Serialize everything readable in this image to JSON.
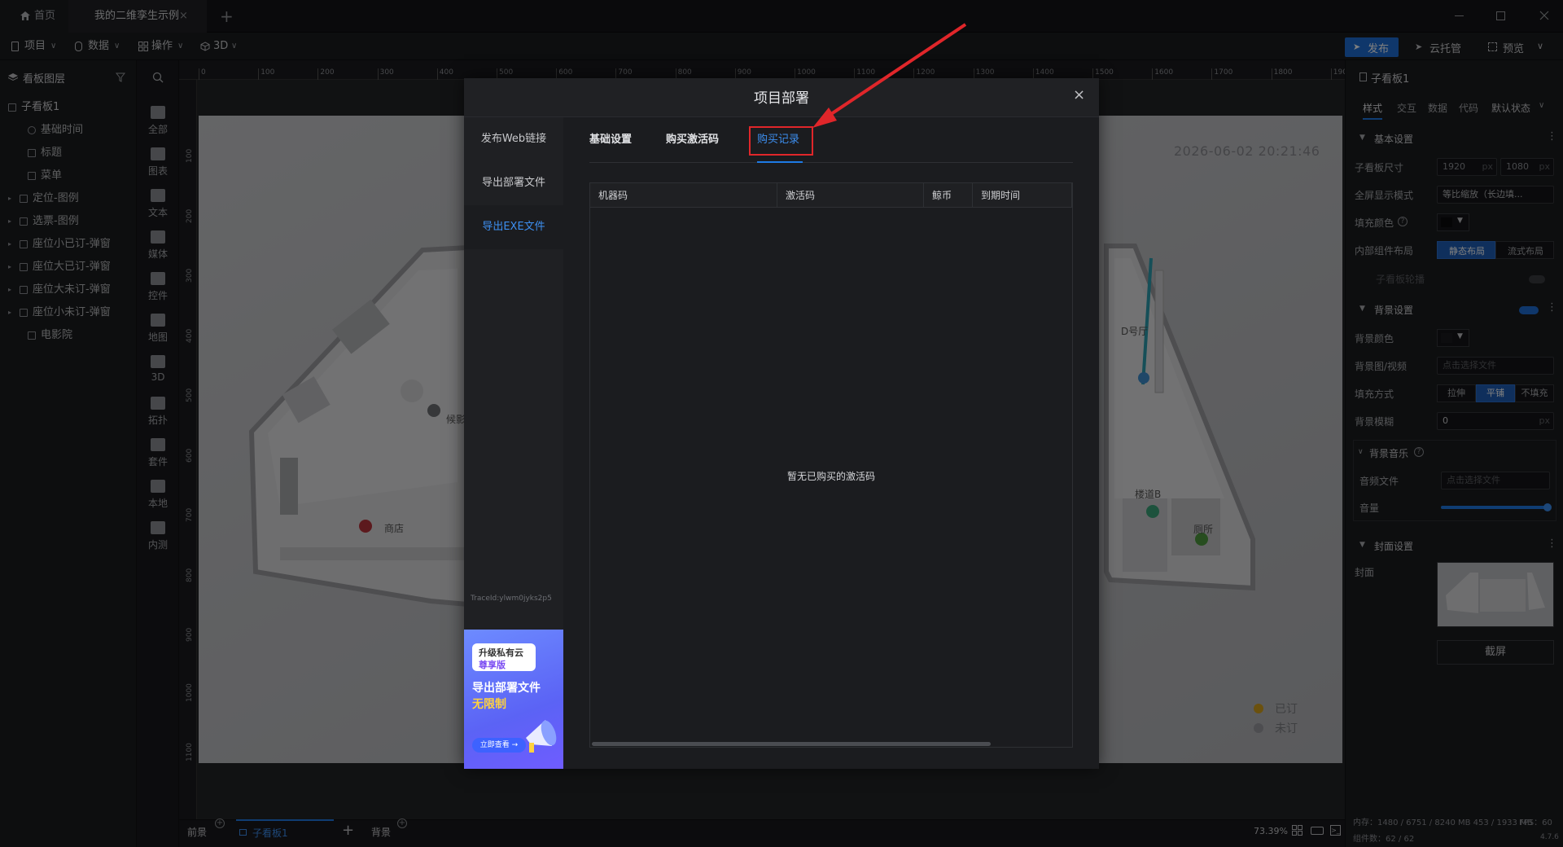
{
  "titlebar": {
    "home_tab": "首页",
    "doc_tab": "我的二维孪生示例",
    "close_glyph": "×",
    "add_glyph": "+"
  },
  "toolbar": {
    "project": "项目",
    "data": "数据",
    "operation": "操作",
    "three_d": "3D",
    "publish": "发布",
    "cloud": "云托管",
    "preview": "预览"
  },
  "left_panel": {
    "title": "看板图层",
    "items": [
      {
        "label": "子看板1",
        "icon": "monitor-icon"
      },
      {
        "label": "基础时间",
        "icon": "clock-icon"
      },
      {
        "label": "标题",
        "icon": "text-icon"
      },
      {
        "label": "菜单",
        "icon": "menu-icon"
      },
      {
        "label": "定位-图例",
        "icon": "folder-icon"
      },
      {
        "label": "选票-图例",
        "icon": "folder-icon"
      },
      {
        "label": "座位小已订-弹窗",
        "icon": "folder-icon"
      },
      {
        "label": "座位大已订-弹窗",
        "icon": "folder-icon"
      },
      {
        "label": "座位大未订-弹窗",
        "icon": "folder-icon"
      },
      {
        "label": "座位小未订-弹窗",
        "icon": "folder-icon"
      },
      {
        "label": "电影院",
        "icon": "image-icon"
      }
    ]
  },
  "icon_bar": {
    "categories": [
      "全部",
      "图表",
      "文本",
      "媒体",
      "控件",
      "地图",
      "3D",
      "拓扑",
      "套件",
      "本地",
      "内测"
    ]
  },
  "ruler": {
    "top_ticks": [
      "0",
      "100",
      "200",
      "300",
      "400",
      "500",
      "600",
      "700",
      "800",
      "900",
      "1000",
      "1100",
      "1200",
      "1300",
      "1400",
      "1500",
      "1600",
      "1700",
      "1800",
      "1900"
    ],
    "left_ticks": [
      "100",
      "200",
      "300",
      "400",
      "500",
      "600",
      "700",
      "800",
      "900",
      "1000",
      "1100"
    ]
  },
  "board": {
    "datetime": "2026-06-02 20:21:46",
    "labels": {
      "shop": "商店",
      "lounge": "候影",
      "hall_d": "D号厅",
      "stair_b": "楼道B",
      "toilet": "厕所"
    },
    "legend": {
      "booked": "已订",
      "free": "未订",
      "booked_color": "#d7a21d",
      "free_color": "#9a9ba0"
    }
  },
  "right_panel": {
    "title": "子看板1",
    "tabs": [
      "样式",
      "交互",
      "数据",
      "代码"
    ],
    "state_select": "默认状态",
    "basic_section": "基本设置",
    "size_label": "子看板尺寸",
    "width": "1920",
    "height": "1080",
    "unit": "px",
    "fullscreen_label": "全屏显示模式",
    "fullscreen_value": "等比缩放（长边填...",
    "fill_color_label": "填充颜色",
    "layout_label": "内部组件布局",
    "layout_static": "静态布局",
    "layout_flow": "流式布局",
    "carousel_label": "子看板轮播",
    "bg_section": "背景设置",
    "bg_color_label": "背景颜色",
    "bg_image_label": "背景图/视频",
    "bg_image_placeholder": "点击选择文件",
    "fill_mode_label": "填充方式",
    "fill_stretch": "拉伸",
    "fill_tile": "平铺",
    "fill_none": "不填充",
    "bg_blur_label": "背景模糊",
    "bg_blur_value": "0",
    "music_section": "背景音乐",
    "audio_label": "音频文件",
    "audio_placeholder": "点击选择文件",
    "volume_label": "音量",
    "volume_fraction": 1.0,
    "cover_section": "封面设置",
    "cover_label": "封面",
    "screenshot_button": "截屏",
    "memory": "内存：1480 / 6751 / 8240 MB  453 / 1933 MB",
    "fps": "FPS：60",
    "component_count": "组件数：62 / 62",
    "version": "4.7.6"
  },
  "bottom_bar": {
    "front": "前景",
    "board": "子看板1",
    "background": "背景",
    "zoom": "73.39%"
  },
  "modal": {
    "title": "项目部署",
    "close_glyph": "×",
    "side_items": [
      "发布Web链接",
      "导出部署文件",
      "导出EXE文件"
    ],
    "active_side": 2,
    "trace_id": "TraceId:ylwm0jyks2p5",
    "tabs": [
      "基础设置",
      "购买激活码",
      "购买记录"
    ],
    "active_tab": 2,
    "columns": [
      "机器码",
      "激活码",
      "鲸币",
      "到期时间"
    ],
    "empty_text": "暂无已购买的激活码",
    "promo": {
      "badge_line1": "升级私有云",
      "badge_line2": "尊享版",
      "line1": "导出部署文件",
      "line2": "无限制",
      "button": "立即查看 →"
    }
  },
  "colors": {
    "accent": "#1e7be6",
    "annotation": "#e0262a",
    "background": "#1d1e21"
  }
}
